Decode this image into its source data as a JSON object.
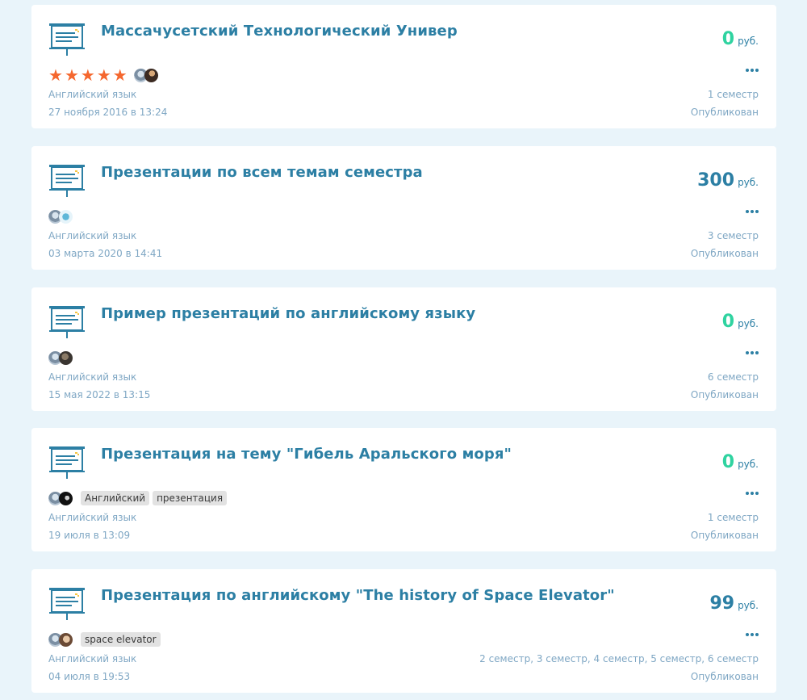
{
  "accent": "#2c7fa4",
  "free_color": "#2fd3a0",
  "star_color": "#f5672e",
  "cards": [
    {
      "icon": "presentation-board-icon",
      "title": "Массачусетский Технологический Универ",
      "price": "0",
      "currency": "руб.",
      "rating_stars": 5,
      "star_glyph": "★",
      "avatars": [
        "emblem-avatar",
        "portrait-avatar"
      ],
      "tags": [],
      "subject": "Английский язык",
      "semester": "1 семестр",
      "date": "27 ноября 2016 в 13:24",
      "status": "Опубликован"
    },
    {
      "icon": "presentation-board-icon",
      "title": "Презентации по всем темам семестра",
      "price": "300",
      "currency": "руб.",
      "avatars": [
        "emblem-avatar",
        "figure-avatar"
      ],
      "tags": [],
      "subject": "Английский язык",
      "semester": "3 семестр",
      "date": "03 марта 2020 в 14:41",
      "status": "Опубликован"
    },
    {
      "icon": "presentation-board-icon",
      "title": "Пример презентаций по английскому языку",
      "price": "0",
      "currency": "руб.",
      "avatars": [
        "emblem-avatar",
        "dark-avatar"
      ],
      "tags": [],
      "subject": "Английский язык",
      "semester": "6 семестр",
      "date": "15 мая 2022 в 13:15",
      "status": "Опубликован"
    },
    {
      "icon": "presentation-board-icon",
      "title": "Презентация на тему \"Гибель Аральского моря\"",
      "price": "0",
      "currency": "руб.",
      "avatars": [
        "emblem-avatar",
        "black-avatar"
      ],
      "tags": [
        "Английский",
        "презентация"
      ],
      "subject": "Английский язык",
      "semester": "1 семестр",
      "date": "19 июля в 13:09",
      "status": "Опубликован"
    },
    {
      "icon": "presentation-board-icon",
      "title": "Презентация по английскому \"The history of Space Elevator\"",
      "price": "99",
      "currency": "руб.",
      "avatars": [
        "emblem-avatar",
        "face-avatar"
      ],
      "tags": [
        "space elevator"
      ],
      "subject": "Английский язык",
      "semester": "2 семестр, 3 семестр, 4 семестр, 5 семестр, 6 семестр",
      "date": "04 июля в 19:53",
      "status": "Опубликован"
    }
  ]
}
